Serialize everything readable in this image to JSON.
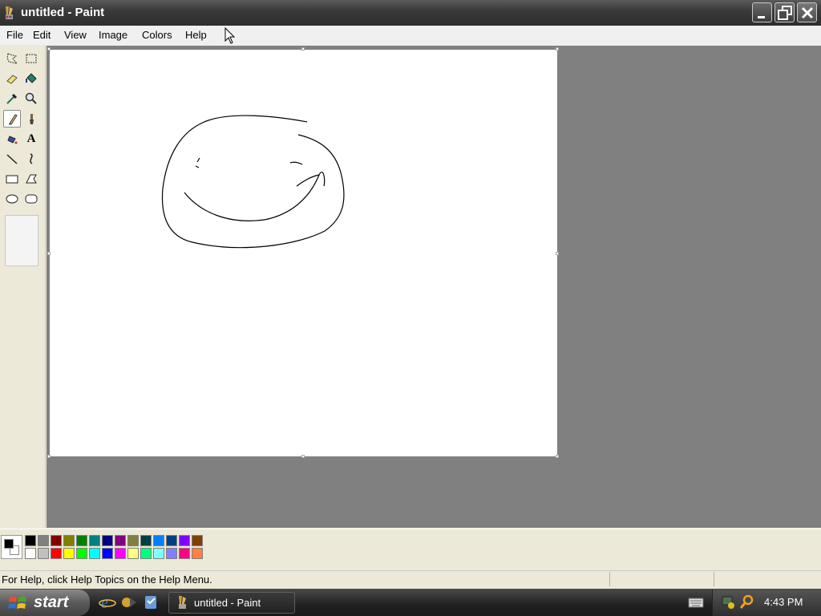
{
  "window": {
    "title": "untitled - Paint",
    "title_icon": "paint-app-icon",
    "controls": [
      "minimize-icon",
      "restore-icon",
      "close-icon"
    ]
  },
  "menubar": {
    "items": [
      "File",
      "Edit",
      "View",
      "Image",
      "Colors",
      "Help"
    ]
  },
  "toolbox": {
    "tools": [
      "free-form-select-icon",
      "select-icon",
      "eraser-icon",
      "fill-with-color-icon",
      "pick-color-icon",
      "magnifier-icon",
      "pencil-icon",
      "brush-icon",
      "airbrush-icon",
      "text-icon",
      "line-icon",
      "curve-icon",
      "rectangle-icon",
      "polygon-icon",
      "ellipse-icon",
      "rounded-rectangle-icon"
    ],
    "selected_tool": "pencil-icon",
    "text_tool_glyph": "A"
  },
  "canvas": {
    "drawing": "smiley-face-sketch",
    "background": "#ffffff"
  },
  "palette": {
    "foreground": "#000000",
    "background": "#ffffff",
    "row1": [
      "#000000",
      "#808080",
      "#800000",
      "#808000",
      "#008000",
      "#008080",
      "#000080",
      "#800080",
      "#808040",
      "#004040",
      "#0080ff",
      "#004080",
      "#8000ff",
      "#804000"
    ],
    "row2": [
      "#ffffff",
      "#c0c0c0",
      "#ff0000",
      "#ffff00",
      "#00ff00",
      "#00ffff",
      "#0000ff",
      "#ff00ff",
      "#ffff80",
      "#00ff80",
      "#80ffff",
      "#8080ff",
      "#ff0080",
      "#ff8040"
    ]
  },
  "statusbar": {
    "text": "For Help, click Help Topics on the Help Menu."
  },
  "taskbar": {
    "start_label": "start",
    "quick_launch": [
      "internet-explorer-icon",
      "media-player-icon",
      "outlook-express-icon"
    ],
    "tasks": [
      {
        "label": "untitled - Paint",
        "icon": "paint-app-icon"
      }
    ],
    "tray_icons": [
      "keyboard-icon",
      "network-icon",
      "search-icon"
    ],
    "clock": "4:43 PM"
  }
}
